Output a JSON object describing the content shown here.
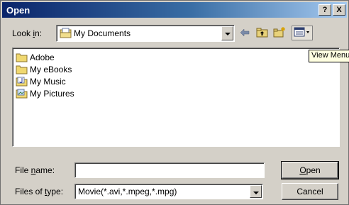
{
  "window": {
    "title": "Open",
    "help_label": "?",
    "close_label": "X"
  },
  "look_in": {
    "label_prefix": "Look ",
    "label_accel": "i",
    "label_suffix": "n:",
    "value": "My Documents"
  },
  "toolbar": {
    "icons": [
      "back-arrow-icon",
      "up-folder-icon",
      "new-folder-icon",
      "view-menu-icon"
    ],
    "tooltip": "View Menu"
  },
  "file_list": {
    "items": [
      {
        "label": "Adobe",
        "icon": "folder-icon"
      },
      {
        "label": "My eBooks",
        "icon": "folder-icon"
      },
      {
        "label": "My Music",
        "icon": "music-folder-icon"
      },
      {
        "label": "My Pictures",
        "icon": "pictures-folder-icon"
      }
    ]
  },
  "file_name": {
    "label_prefix": "File ",
    "label_accel": "n",
    "label_suffix": "ame:",
    "value": "",
    "placeholder": ""
  },
  "file_type": {
    "label_prefix": "Files of ",
    "label_accel": "t",
    "label_suffix": "ype:",
    "value": "Movie(*.avi,*.mpeg,*.mpg)"
  },
  "buttons": {
    "open_accel": "O",
    "open_rest": "pen",
    "cancel": "Cancel"
  },
  "colors": {
    "title_start": "#0a246a",
    "title_end": "#a6caf0",
    "face": "#d4d0c8",
    "tooltip_bg": "#ffffe1"
  }
}
